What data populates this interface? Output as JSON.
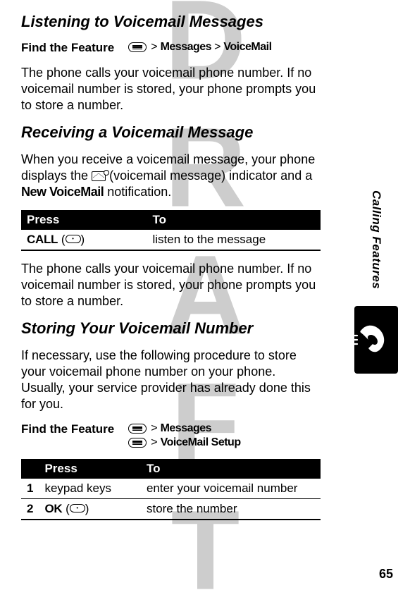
{
  "watermark": "DRAFT",
  "page_number": "65",
  "side_label": "Calling Features",
  "sections": {
    "listen": {
      "heading": "Listening to Voicemail Messages",
      "find_the_feature_label": "Find the Feature",
      "path_gt": ">",
      "path_messages": "Messages",
      "path_voicemail": "VoiceMail",
      "body": "The phone calls your voicemail phone number. If no voicemail number is stored, your phone prompts you to store a number."
    },
    "receive": {
      "heading": "Receiving a Voicemail Message",
      "body_pre": "When you receive a voicemail message, your phone displays the ",
      "body_mid": " (voicemail message) indicator and a ",
      "new_voicemail": "New VoiceMail",
      "body_post": " notification.",
      "table_head_press": "Press",
      "table_head_to": "To",
      "row_press_call": "CALL",
      "row_press_paren_open": " (",
      "row_press_paren_close": ")",
      "row_to": "listen to the message",
      "body_below": "The phone calls your voicemail phone number. If no voicemail number is stored, your phone prompts you to store a number."
    },
    "store": {
      "heading": "Storing Your Voicemail Number",
      "body": "If necessary, use the following procedure to store your voicemail phone number on your phone. Usually, your service provider has already done this for you.",
      "find_the_feature_label": "Find the Feature",
      "path_gt": ">",
      "path_messages": "Messages",
      "path_vmsetup": "VoiceMail Setup",
      "table_head_blank": "",
      "table_head_press": "Press",
      "table_head_to": "To",
      "rows": [
        {
          "n": "1",
          "press": "keypad keys",
          "to": "enter your voicemail number"
        },
        {
          "n": "2",
          "press_key": "OK",
          "to": "store the number"
        }
      ]
    }
  }
}
